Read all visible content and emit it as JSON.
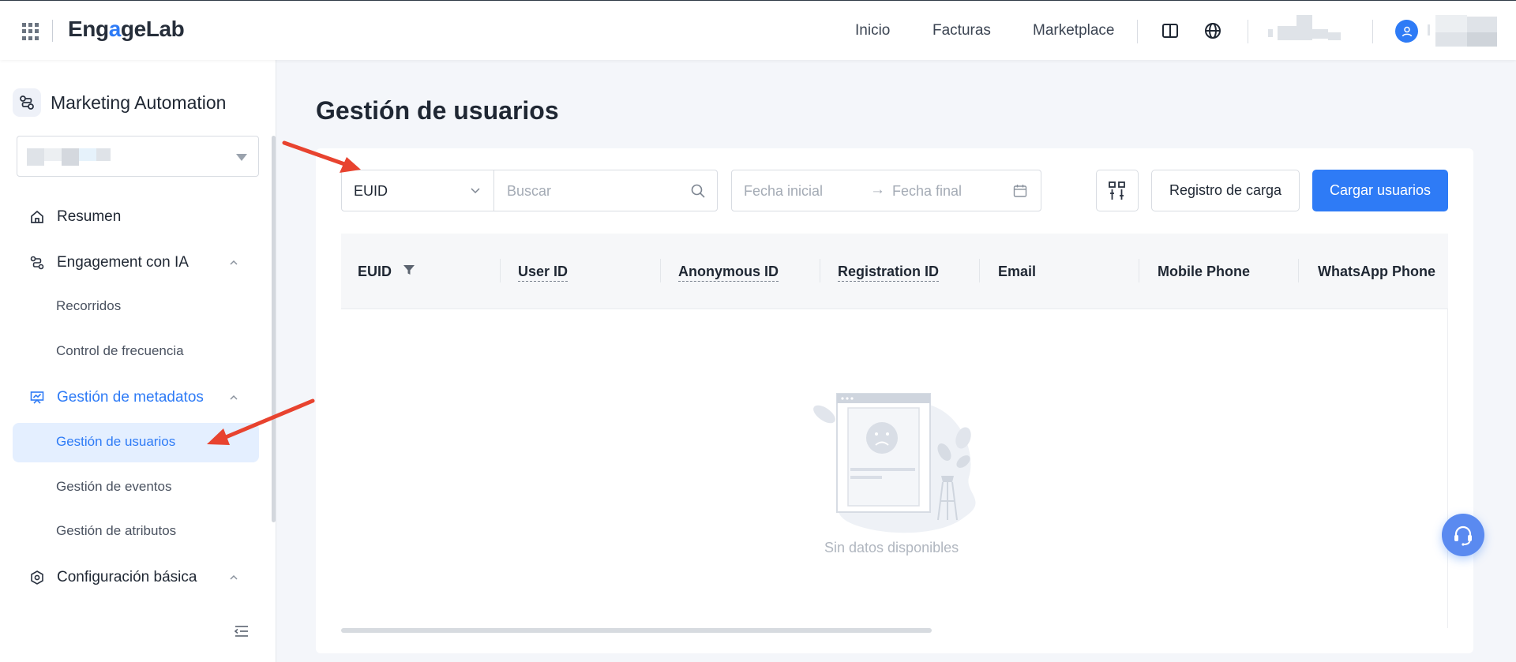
{
  "header": {
    "brand_prefix": "Eng",
    "brand_accent": "a",
    "brand_suffix": "geLab",
    "nav": [
      "Inicio",
      "Facturas",
      "Marketplace"
    ]
  },
  "sidebar": {
    "app_name": "Marketing Automation",
    "menu": [
      {
        "label": "Resumen"
      },
      {
        "label": "Engagement con IA"
      },
      {
        "label": "Gestión de metadatos"
      },
      {
        "label": "Configuración básica"
      }
    ],
    "sub": [
      {
        "label": "Recorridos"
      },
      {
        "label": "Control de frecuencia"
      },
      {
        "label": "Gestión de usuarios"
      },
      {
        "label": "Gestión de eventos"
      },
      {
        "label": "Gestión de atributos"
      }
    ]
  },
  "main": {
    "title": "Gestión de usuarios",
    "field_select": "EUID",
    "search_placeholder": "Buscar",
    "date_start_placeholder": "Fecha inicial",
    "date_end_placeholder": "Fecha final",
    "date_arrow": "→",
    "upload_log_label": "Registro de carga",
    "upload_users_label": "Cargar usuarios",
    "columns": [
      "EUID",
      "User ID",
      "Anonymous ID",
      "Registration ID",
      "Email",
      "Mobile Phone",
      "WhatsApp Phone"
    ],
    "empty_text": "Sin datos disponibles"
  },
  "colors": {
    "accent": "#2e7bf6",
    "annotation_arrow": "#e8432f"
  }
}
